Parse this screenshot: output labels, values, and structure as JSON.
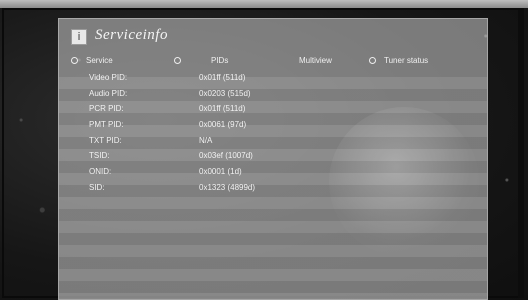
{
  "window": {
    "title": "Serviceinfo",
    "title_icon": "info-icon"
  },
  "tabs": [
    {
      "label": "Service",
      "icon": "radio-circle-icon"
    },
    {
      "label": "PIDs",
      "icon": "radio-circle-icon"
    },
    {
      "label": "Multiview",
      "icon": ""
    },
    {
      "label": "Tuner status",
      "icon": "radio-circle-icon"
    }
  ],
  "rows": [
    {
      "label": "Video PID:",
      "value": "0x01ff (511d)"
    },
    {
      "label": "Audio PID:",
      "value": "0x0203 (515d)"
    },
    {
      "label": "PCR PID:",
      "value": "0x01ff (511d)"
    },
    {
      "label": "PMT PID:",
      "value": "0x0061 (97d)"
    },
    {
      "label": "TXT PID:",
      "value": "N/A"
    },
    {
      "label": "TSID:",
      "value": "0x03ef (1007d)"
    },
    {
      "label": "ONID:",
      "value": "0x0001 (1d)"
    },
    {
      "label": "SID:",
      "value": "0x1323 (4899d)"
    }
  ],
  "colors": {
    "panel": "#b9b9b9",
    "text": "#f2f2f2",
    "background": "#1a1a1a"
  }
}
